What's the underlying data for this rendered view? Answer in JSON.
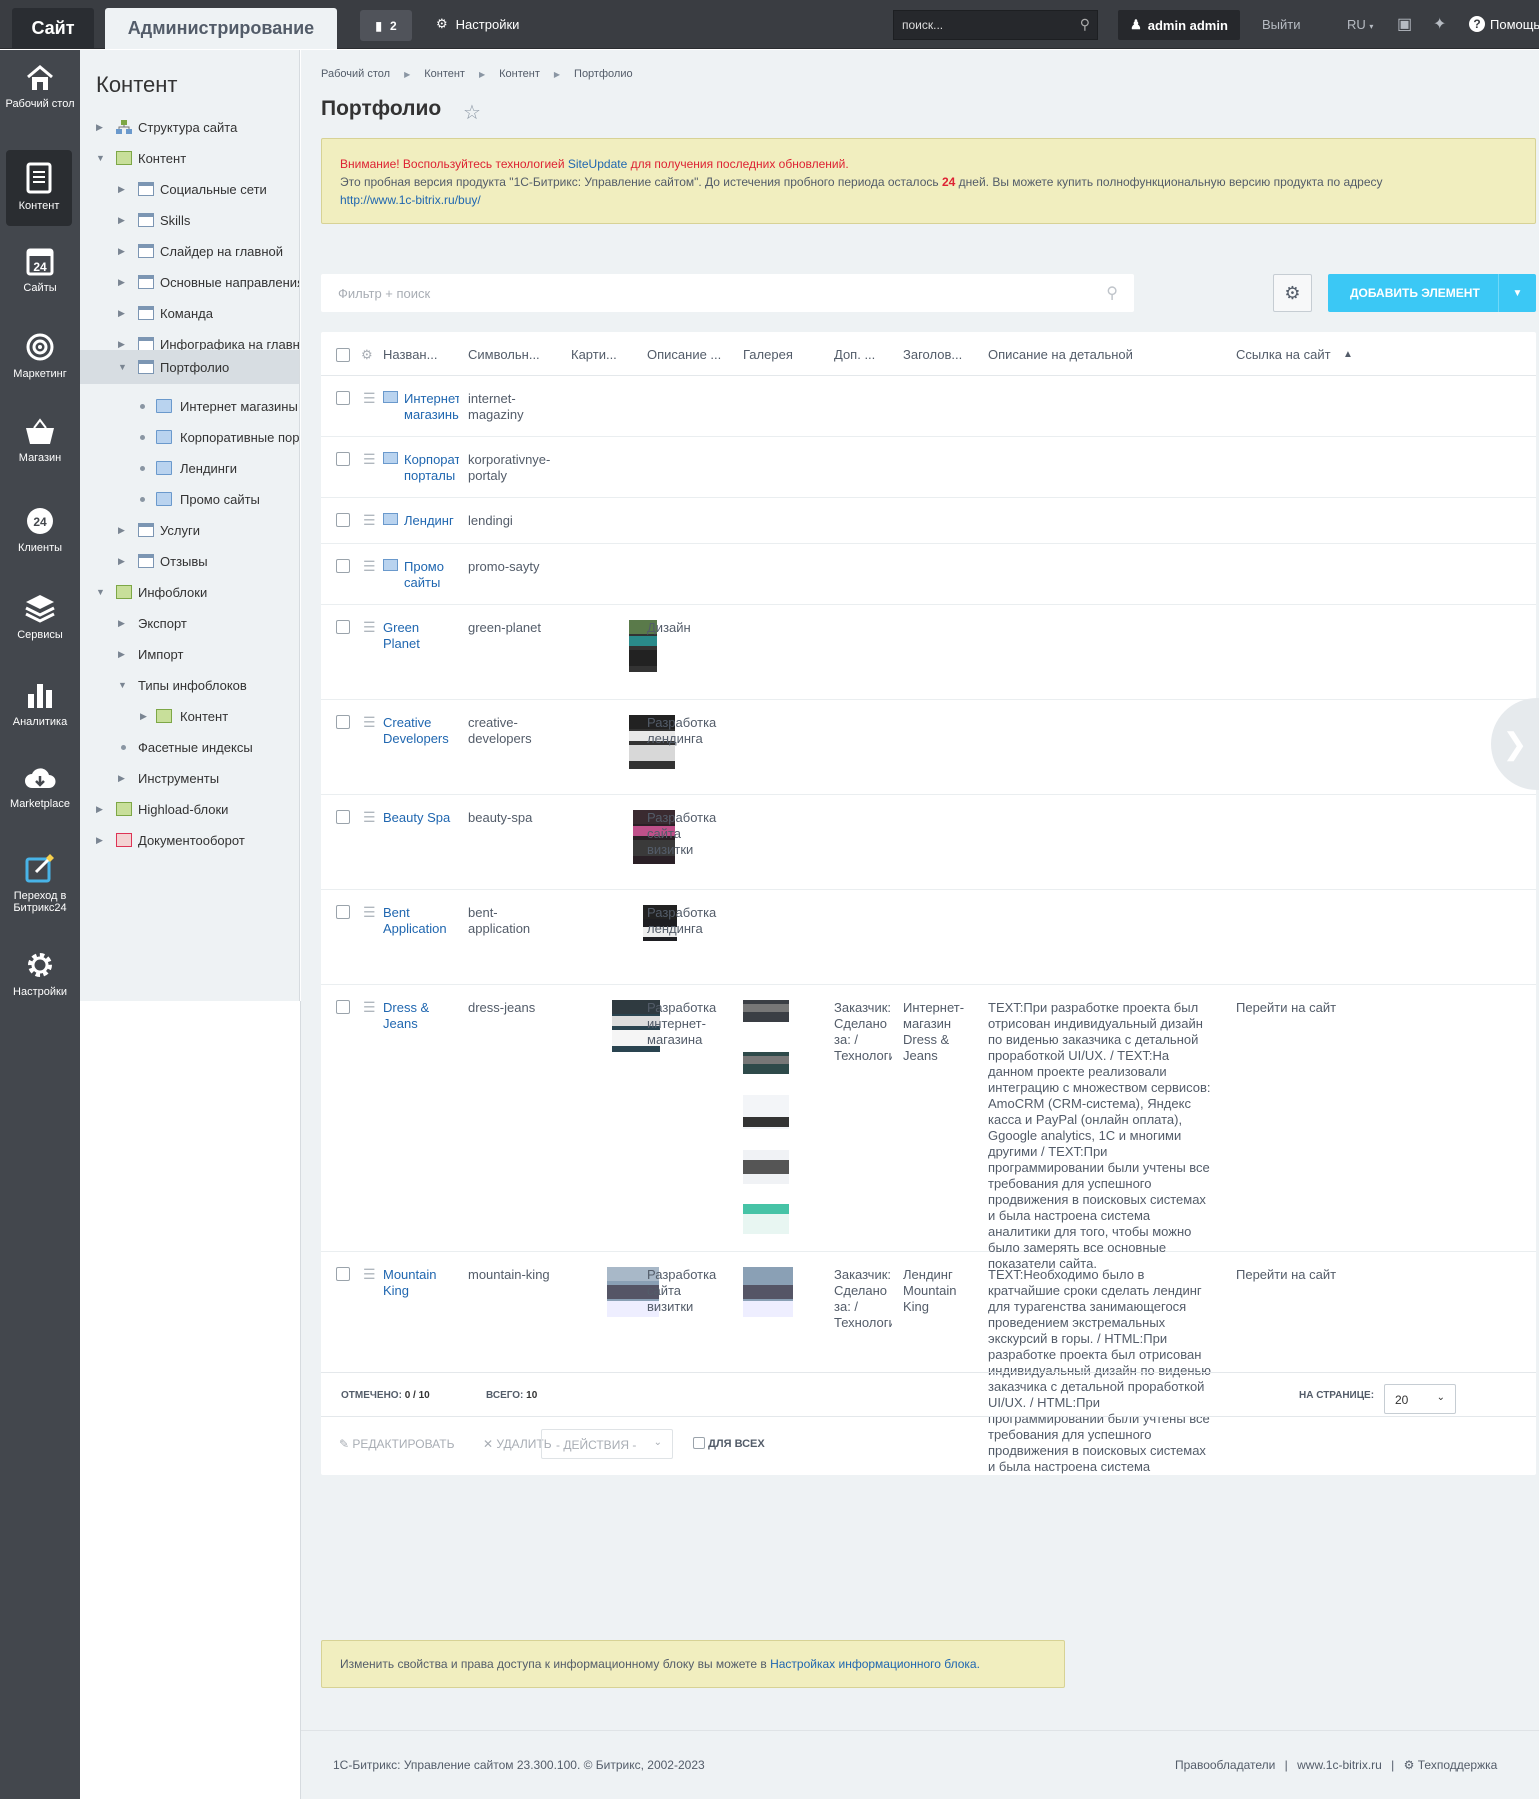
{
  "topbar": {
    "site_tab": "Сайт",
    "admin_tab": "Администрирование",
    "notif_count": "2",
    "settings": "Настройки",
    "search_placeholder": "поиск...",
    "user": "admin admin",
    "exit": "Выйти",
    "lang": "RU",
    "help": "Помощь"
  },
  "leftnav": [
    {
      "label": "Рабочий стол"
    },
    {
      "label": "Контент"
    },
    {
      "label": "Сайты"
    },
    {
      "label": "Маркетинг"
    },
    {
      "label": "Магазин"
    },
    {
      "label": "Клиенты"
    },
    {
      "label": "Сервисы"
    },
    {
      "label": "Аналитика"
    },
    {
      "label": "Marketplace"
    },
    {
      "label": "Переход в Битрикс24"
    },
    {
      "label": "Настройки"
    }
  ],
  "tree": {
    "title": "Контент",
    "items": [
      {
        "label": "Структура сайта"
      },
      {
        "label": "Контент"
      },
      {
        "label": "Социальные сети"
      },
      {
        "label": "Skills"
      },
      {
        "label": "Слайдер на главной"
      },
      {
        "label": "Основные направления"
      },
      {
        "label": "Команда"
      },
      {
        "label": "Инфографика на главной"
      },
      {
        "label": "Портфолио"
      },
      {
        "label": "Интернет магазины"
      },
      {
        "label": "Корпоративные порталы"
      },
      {
        "label": "Лендинги"
      },
      {
        "label": "Промо сайты"
      },
      {
        "label": "Услуги"
      },
      {
        "label": "Отзывы"
      },
      {
        "label": "Инфоблоки"
      },
      {
        "label": "Экспорт"
      },
      {
        "label": "Импорт"
      },
      {
        "label": "Типы инфоблоков"
      },
      {
        "label": "Контент"
      },
      {
        "label": "Фасетные индексы"
      },
      {
        "label": "Инструменты"
      },
      {
        "label": "Highload-блоки"
      },
      {
        "label": "Документооборот"
      }
    ]
  },
  "breadcrumbs": [
    "Рабочий стол",
    "Контент",
    "Контент",
    "Портфолио"
  ],
  "page_title": "Портфолио",
  "warning": {
    "line1_a": "Внимание! Воспользуйтесь технологией ",
    "line1_link": "SiteUpdate",
    "line1_b": " для получения последних обновлений.",
    "line2_a": "Это пробная версия продукта \"1С-Битрикс: Управление сайтом\". До истечения пробного периода осталось ",
    "days": "24",
    "line2_b": " дней. Вы можете купить полнофункциональную версию продукта по адресу",
    "link": "http://www.1c-bitrix.ru/buy/"
  },
  "filter_placeholder": "Фильтр + поиск",
  "add_button": "ДОБАВИТЬ ЭЛЕМЕНТ",
  "columns": {
    "name": "Назван...",
    "sym": "Символьн...",
    "pic": "Карти...",
    "desc": "Описание ...",
    "gal": "Галерея",
    "dop": "Доп. ...",
    "zag": "Заголов...",
    "det": "Описание на детальной",
    "link": "Ссылка на сайт"
  },
  "rows": [
    {
      "name": "Интернет магазины",
      "sym": "internet-magaziny"
    },
    {
      "name": "Корпоративные порталы",
      "sym": "korporativnye-portaly"
    },
    {
      "name": "Лендинг",
      "sym": "lendingi"
    },
    {
      "name": "Промо сайты",
      "sym": "promo-sayty"
    },
    {
      "name": "Green Planet",
      "sym": "green-planet",
      "desc": "Дизайн"
    },
    {
      "name": "Creative Developers",
      "sym": "creative-developers",
      "desc": "Разработка лендинга"
    },
    {
      "name": "Beauty Spa",
      "sym": "beauty-spa",
      "desc": "Разработка сайта визитки"
    },
    {
      "name": "Bent Application",
      "sym": "bent-application",
      "desc": "Разработка лендинга"
    },
    {
      "name": "Dress & Jeans",
      "sym": "dress-jeans",
      "desc": "Разработка интернет-магазина",
      "dop": "Заказчик: Сделано за: / Технологии",
      "zag": "Интернет-магазин Dress & Jeans",
      "det": "TEXT:При разработке проекта был отрисован индивидуальный дизайн по виденью заказчика с детальной проработкой UI/UX. / TEXT:На данном проекте реализовали интеграцию с множеством сервисов: AmoCRM (CRM-система), Яндекс касса и PayPal (онлайн оплата), Ggoogle analytics, 1C и многими другими / TEXT:При программировании были учтены все требования для успешного продвижения в поисковых системах и была настроена система аналитики для того, чтобы можно было замерять все основные показатели сайта.",
      "link": "Перейти на сайт"
    },
    {
      "name": "Mountain King",
      "sym": "mountain-king",
      "desc": "Разработка сайта визитки",
      "dop": "Заказчик: Сделано за: / Технологии",
      "zag": "Лендинг Mountain King",
      "det": "TEXT:Необходимо было в кратчайшие сроки сделать лендинг для турагенства занимающегося проведением экстремальных экскурсий в горы. / HTML:При разработке проекта был отрисован индивидуальный дизайн по виденью заказчика с детальной проработкой UI/UX. / HTML:При программировании были учтены все требования для успешного продвижения в поисковых системах и была настроена система аналитики для того, чтобы можно было замерять все основные показатели сайта.",
      "link": "Перейти на сайт"
    }
  ],
  "grid_footer": {
    "selected_label": "ОТМЕЧЕНО:",
    "selected": "0 / 10",
    "total_label": "ВСЕГО:",
    "total": "10",
    "per_page_label": "НА СТРАНИЦЕ:",
    "per_page": "20"
  },
  "actions": {
    "edit": "РЕДАКТИРОВАТЬ",
    "delete": "УДАЛИТЬ",
    "actions": "- ДЕЙСТВИЯ -",
    "for_all": "ДЛЯ ВСЕХ"
  },
  "note": {
    "text": "Изменить свойства и права доступа к информационному блоку вы можете в ",
    "link": "Настройках информационного блока."
  },
  "footer": {
    "copyright": "1С-Битрикс: Управление сайтом 23.300.100. © Битрикс, 2002-2023",
    "rights": "Правообладатели",
    "site": "www.1c-bitrix.ru",
    "support": "Техподдержка"
  }
}
